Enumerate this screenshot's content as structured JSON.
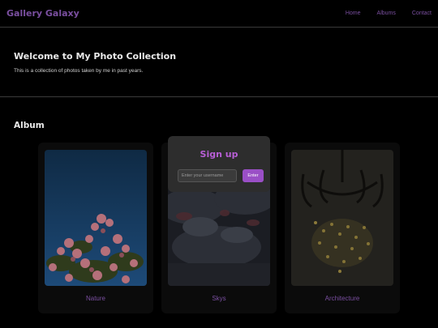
{
  "navbar": {
    "brand": "Gallery Galaxy",
    "links": [
      {
        "label": "Home"
      },
      {
        "label": "Albums"
      },
      {
        "label": "Contact"
      }
    ]
  },
  "hero": {
    "title": "Welcome to My Photo Collection",
    "subtitle": "This is a collection of photos taken by me in past years."
  },
  "album": {
    "heading": "Album",
    "cards": [
      {
        "label": "Nature",
        "image": "pink-flowers-blue-sky"
      },
      {
        "label": "Skys",
        "image": "cloudy-sky"
      },
      {
        "label": "Architecture",
        "image": "crystal-chandelier"
      }
    ]
  },
  "signup_modal": {
    "title": "Sign up",
    "username_placeholder": "Enter your username",
    "username_value": "",
    "enter_label": "Enter"
  },
  "colors": {
    "background": "#000000",
    "accent": "#9a4fc6",
    "nav_text": "#7a4fa0",
    "modal_bg": "#2d2d2d"
  }
}
